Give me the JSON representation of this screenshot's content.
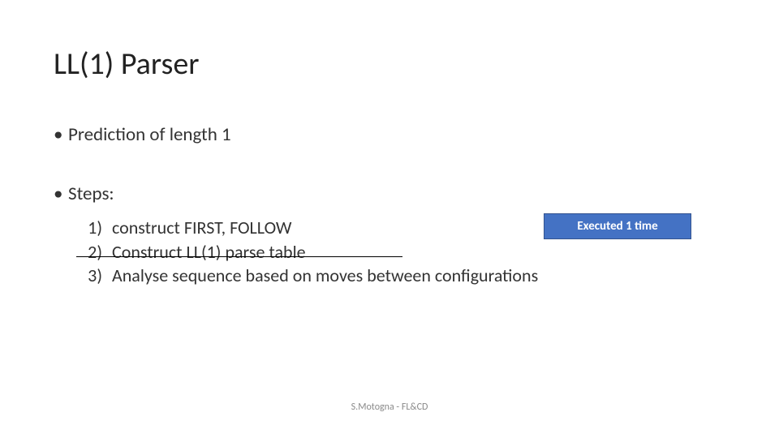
{
  "title": "LL(1) Parser",
  "bullets": {
    "b1": "Prediction of length 1",
    "b2": "Steps:"
  },
  "dot": "•",
  "steps": [
    {
      "num": "1)",
      "text": "construct FIRST, FOLLOW"
    },
    {
      "num": "2)",
      "text": "Construct LL(1) parse table"
    },
    {
      "num": "3)",
      "text": "Analyse sequence based on moves between configurations"
    }
  ],
  "badge": "Executed 1 time",
  "footer": "S.Motogna - FL&CD"
}
